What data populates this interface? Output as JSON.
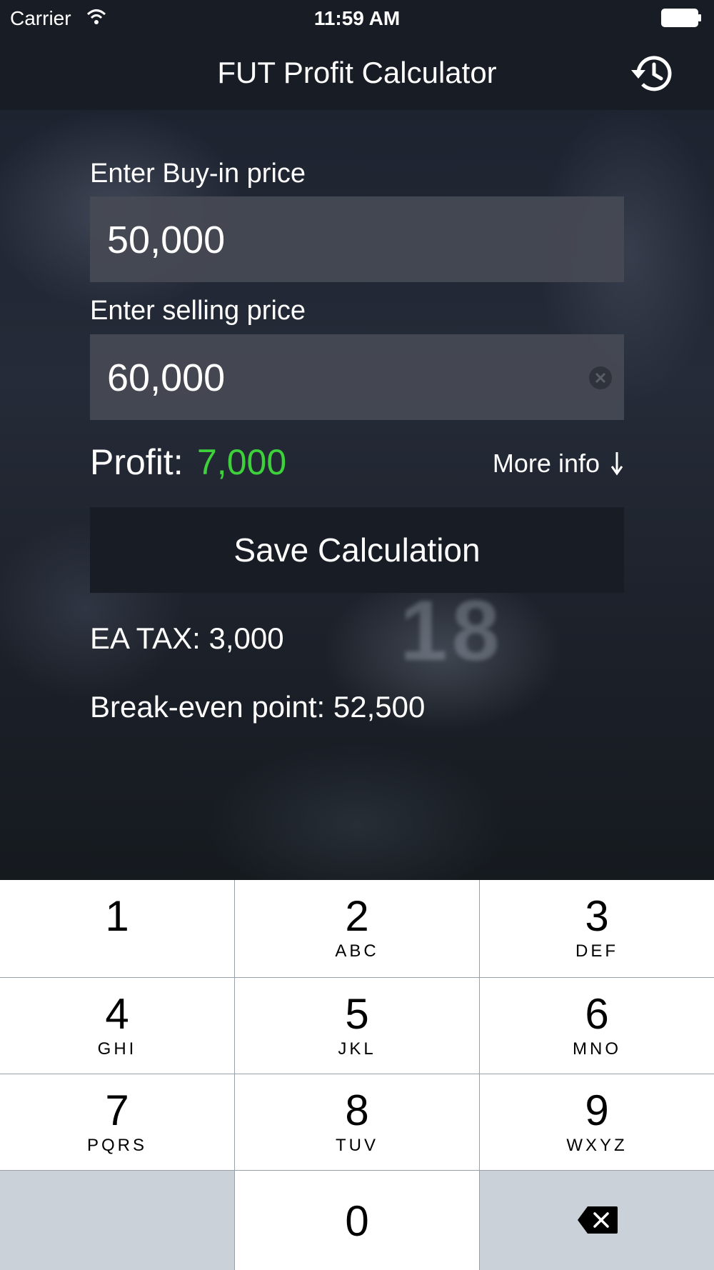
{
  "status_bar": {
    "carrier": "Carrier",
    "time": "11:59 AM"
  },
  "nav": {
    "title": "FUT Profit Calculator",
    "history_icon": "history-clock-icon"
  },
  "form": {
    "buy_label": "Enter Buy-in price",
    "buy_value": "50,000",
    "sell_label": "Enter selling price",
    "sell_value": "60,000",
    "profit_label": "Profit:",
    "profit_value": "7,000",
    "profit_color": "#3ed13c",
    "more_info": "More info",
    "save_label": "Save Calculation",
    "ea_tax": "EA TAX: 3,000",
    "break_even": "Break-even point: 52,500"
  },
  "background": {
    "jersey_number": "18"
  },
  "keypad": {
    "keys": [
      {
        "num": "1",
        "letters": ""
      },
      {
        "num": "2",
        "letters": "ABC"
      },
      {
        "num": "3",
        "letters": "DEF"
      },
      {
        "num": "4",
        "letters": "GHI"
      },
      {
        "num": "5",
        "letters": "JKL"
      },
      {
        "num": "6",
        "letters": "MNO"
      },
      {
        "num": "7",
        "letters": "PQRS"
      },
      {
        "num": "8",
        "letters": "TUV"
      },
      {
        "num": "9",
        "letters": "WXYZ"
      },
      {
        "num": "0",
        "letters": ""
      }
    ],
    "backspace_icon": "backspace-icon"
  }
}
